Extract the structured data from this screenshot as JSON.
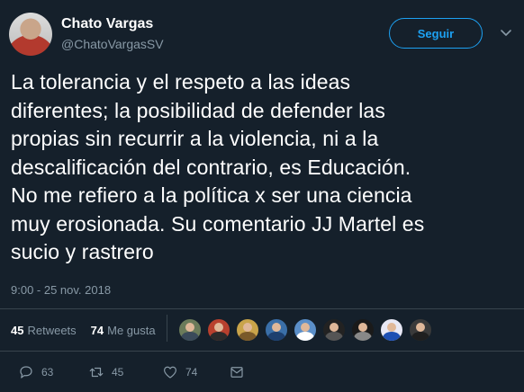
{
  "user": {
    "name": "Chato Vargas",
    "handle": "@ChatoVargasSV",
    "follow_label": "Seguir"
  },
  "tweet": {
    "text": "La tolerancia y el respeto a las ideas\ndiferentes; la posibilidad de defender las\npropias sin recurrir a la violencia, ni a la\ndescalificación del contrario, es Educación.\nNo me refiero a la política x ser una ciencia\nmuy erosionada. Su comentario JJ Martel es\nsucio y rastrero",
    "timestamp": "9:00 - 25 nov. 2018"
  },
  "stats": {
    "retweets_count": "45",
    "retweets_label": "Retweets",
    "likes_count": "74",
    "likes_label": "Me gusta"
  },
  "likers": [
    {
      "icon": "avatar",
      "bg": "#6b7b5a",
      "shirt": "#3a4a5a"
    },
    {
      "icon": "avatar",
      "bg": "#b8402e",
      "shirt": "#2b2b2b"
    },
    {
      "icon": "avatar",
      "bg": "#c9a44a",
      "shirt": "#7a5a2a"
    },
    {
      "icon": "avatar",
      "bg": "#3a6fa8",
      "shirt": "#1d3f6e"
    },
    {
      "icon": "avatar",
      "bg": "#5b8fc9",
      "shirt": "#ffffff"
    },
    {
      "icon": "avatar",
      "bg": "#222222",
      "shirt": "#555555"
    },
    {
      "icon": "avatar",
      "bg": "#1a1a1a",
      "shirt": "#888888"
    },
    {
      "icon": "avatar",
      "bg": "#e8e8f5",
      "shirt": "#1d4fb3"
    },
    {
      "icon": "avatar",
      "bg": "#3a3a3a",
      "shirt": "#1f1f1f"
    }
  ],
  "actions": {
    "replies": "63",
    "retweets": "45",
    "likes": "74"
  },
  "colors": {
    "background": "#15202b",
    "accent": "#1da1f2",
    "muted": "#8899a6",
    "divider": "#38444d"
  }
}
